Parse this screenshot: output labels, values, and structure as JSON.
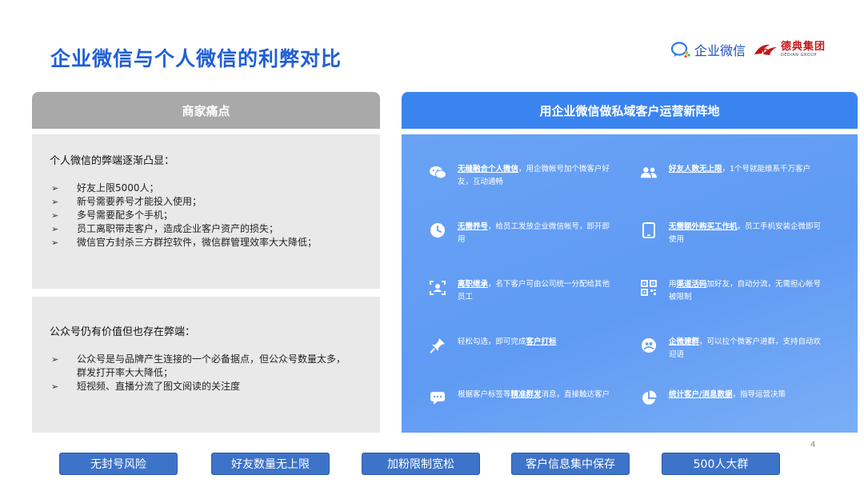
{
  "title": "企业微信与个人微信的利弊对比",
  "logos": {
    "wecom_label": "企业微信",
    "dedian_cn": "德典集团",
    "dedian_en": "DEDIAN GROUP"
  },
  "left": {
    "header": "商家痛点",
    "box1": {
      "title": "个人微信的弊端逐渐凸显：",
      "items": [
        "好友上限5000人；",
        "新号需要养号才能投入使用；",
        "多号需要配多个手机；",
        "员工离职带走客户，造成企业客户资产的损失；",
        "微信官方封杀三方群控软件，微信群管理效率大大降低；"
      ]
    },
    "box2": {
      "title": "公众号仍有价值但也存在弊端：",
      "items": [
        "公众号是与品牌产生连接的一个必备据点，但公众号数量太多，群发打开率大大降低；",
        "短视频、直播分流了图文阅读的关注度"
      ]
    }
  },
  "right": {
    "header": "用企业微信做私域客户运营新阵地",
    "features": [
      {
        "icon": "chat-bubbles-icon",
        "bold": "无缝融合个人微信",
        "pre": "",
        "text": "，用企微帐号加个微客户好友，互动通畅"
      },
      {
        "icon": "users-icon",
        "bold": "好友人数无上限",
        "pre": "",
        "text": "，1个号就能维系千万客户"
      },
      {
        "icon": "clock-icon",
        "bold": "无需养号",
        "pre": "",
        "text": "，给员工发放企业微信帐号，即开即用"
      },
      {
        "icon": "tablet-icon",
        "bold": "无需额外购买工作机",
        "pre": "",
        "text": "，员工手机安装企微即可使用"
      },
      {
        "icon": "scan-user-icon",
        "bold": "离职继承",
        "pre": "",
        "text": "，名下客户可由公司统一分配给其他员工"
      },
      {
        "icon": "qrcode-icon",
        "bold": "渠道活码",
        "pre": "用",
        "text": "加好友，自动分流，无需担心帐号被限制"
      },
      {
        "icon": "pin-icon",
        "bold": "客户打标",
        "pre": "轻松勾选，即可完成",
        "text": ""
      },
      {
        "icon": "group-chat-icon",
        "bold": "企微建群",
        "pre": "",
        "text": "，可以拉个微客户进群，支持自动欢迎语"
      },
      {
        "icon": "message-icon",
        "bold": "精准群发",
        "pre": "根据客户标签等",
        "text": "消息，直接触达客户"
      },
      {
        "icon": "pie-chart-icon",
        "bold": "统计客户/消息数据",
        "pre": "",
        "text": "，指导运营决策"
      }
    ]
  },
  "page_number": "4",
  "pills": [
    "无封号风险",
    "好友数量无上限",
    "加粉限制宽松",
    "客户信息集中保存",
    "500人大群"
  ],
  "colors": {
    "title": "#1f5fd6",
    "right_header": "#3a84f0",
    "left_header": "#a9a9a9",
    "pill": "#3d73c9"
  }
}
